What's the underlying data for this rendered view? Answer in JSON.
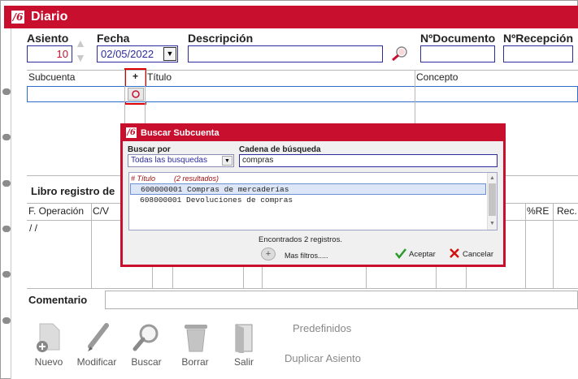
{
  "window": {
    "title": "Diario"
  },
  "header": {
    "asiento_label": "Asiento",
    "asiento_value": "10",
    "fecha_label": "Fecha",
    "fecha_value": "02/05/2022",
    "descripcion_label": "Descripción",
    "descripcion_value": "",
    "ndocumento_label": "NºDocumento",
    "ndocumento_value": "",
    "nrecepcion_label": "NºRecepción",
    "nrecepcion_value": ""
  },
  "grid": {
    "col_subcuenta": "Subcuenta",
    "plus": "+",
    "col_titulo": "Título",
    "col_concepto": "Concepto"
  },
  "libro": {
    "title": "Libro registro de",
    "col_foperacion": "F. Operación",
    "col_cv": "C/V",
    "col_re": "%RE",
    "col_rec": "Rec.",
    "first_cell": "/  /"
  },
  "comentario": {
    "label": "Comentario",
    "value": ""
  },
  "toolbar": {
    "nuevo": "Nuevo",
    "modificar": "Modificar",
    "buscar": "Buscar",
    "borrar": "Borrar",
    "salir": "Salir",
    "predefinidos": "Predefinidos",
    "duplicar": "Duplicar Asiento"
  },
  "dialog": {
    "title": "Buscar Subcuenta",
    "buscar_por_label": "Buscar por",
    "buscar_por_value": "Todas las busquedas",
    "cadena_label": "Cadena de búsqueda",
    "cadena_value": "compras",
    "list_header_col": "# Título",
    "list_header_count": "(2 resultados)",
    "results": [
      {
        "text": "600000001 Compras de mercaderías"
      },
      {
        "text": "608000001 Devoluciones de compras"
      }
    ],
    "found_text": "Encontrados 2 registros.",
    "more_filters": "Mas filtros.....",
    "accept": "Aceptar",
    "cancel": "Cancelar"
  },
  "colors": {
    "brand": "#c8102e",
    "input_border": "#2c2c9e",
    "selection": "#dde6f7"
  }
}
